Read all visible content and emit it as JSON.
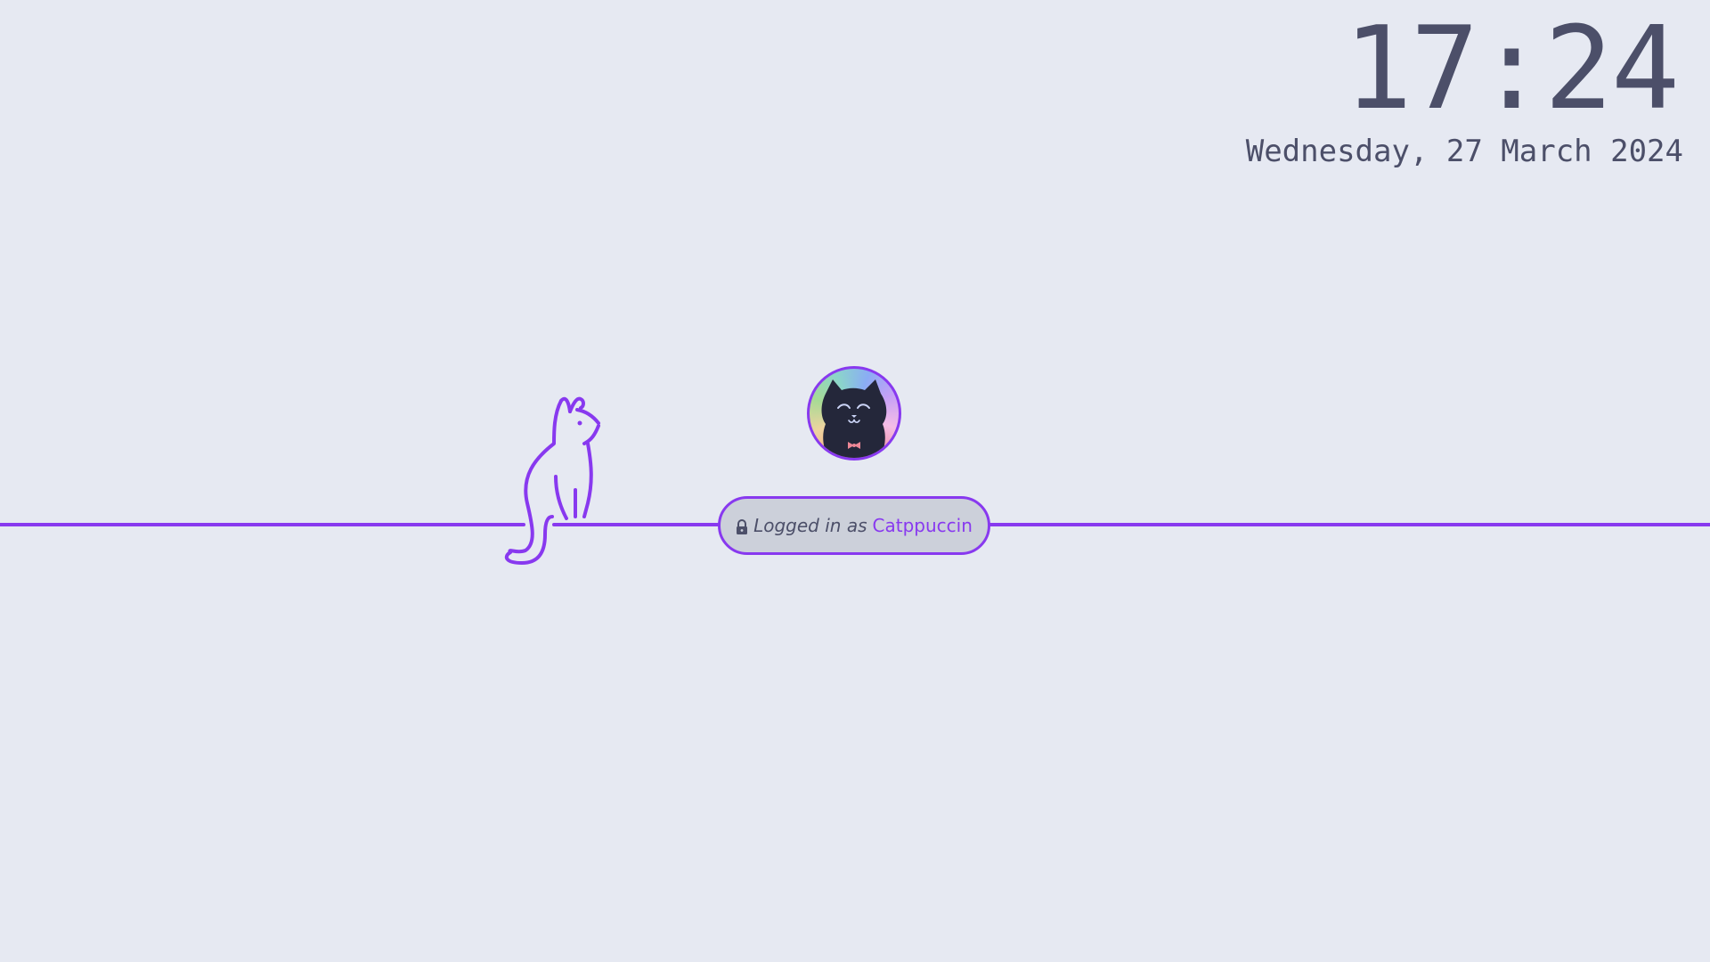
{
  "clock": {
    "time": "17:24",
    "date": "Wednesday, 27 March 2024"
  },
  "login": {
    "prefix": "Logged in as",
    "username": "Catppuccin",
    "lock_icon": "lock-icon"
  },
  "avatar": {
    "icon": "cat-avatar"
  },
  "decoration": {
    "icon": "cat-line-art-icon"
  },
  "colors": {
    "background": "#e6e9f2",
    "accent": "#8839ef",
    "text": "#4c4f69",
    "pill_background": "#ccd0da"
  }
}
